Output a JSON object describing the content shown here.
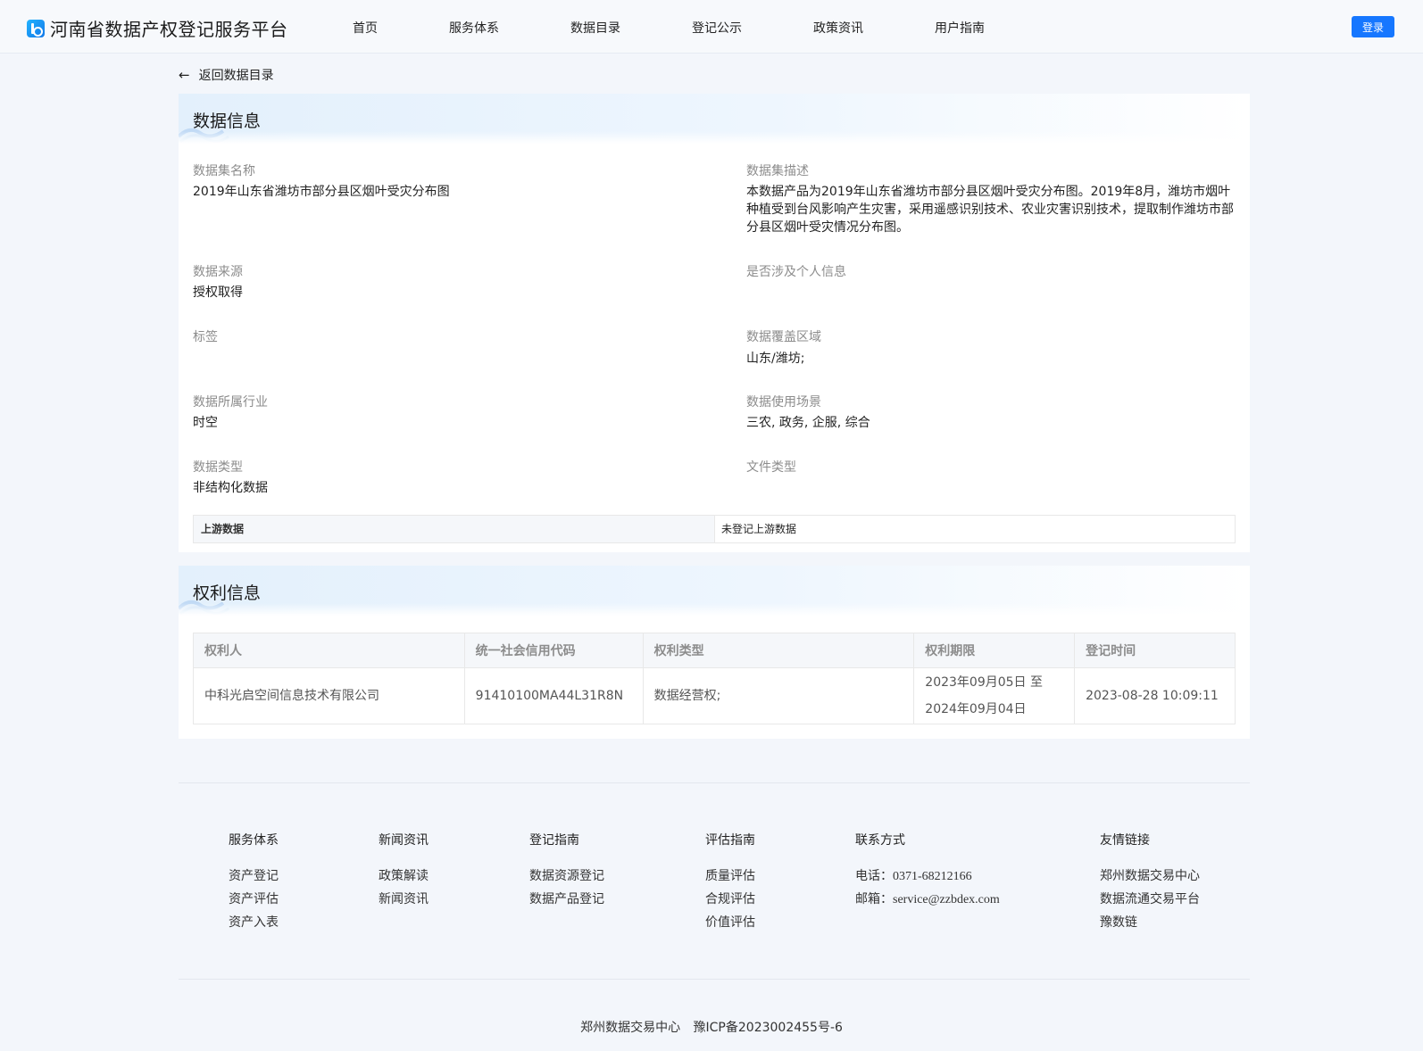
{
  "header": {
    "title": "河南省数据产权登记服务平台",
    "nav": [
      "首页",
      "服务体系",
      "数据目录",
      "登记公示",
      "政策资讯",
      "用户指南"
    ],
    "login": "登录"
  },
  "back_link": "返回数据目录",
  "data_info": {
    "title": "数据信息",
    "fields": {
      "name": {
        "label": "数据集名称",
        "value": "2019年山东省潍坊市部分县区烟叶受灾分布图"
      },
      "description": {
        "label": "数据集描述",
        "value": "本数据产品为2019年山东省潍坊市部分县区烟叶受灾分布图。2019年8月，潍坊市烟叶种植受到台风影响产生灾害，采用遥感识别技术、农业灾害识别技术，提取制作潍坊市部分县区烟叶受灾情况分布图。"
      },
      "source": {
        "label": "数据来源",
        "value": "授权取得"
      },
      "personal_info": {
        "label": "是否涉及个人信息",
        "value": ""
      },
      "tags": {
        "label": "标签",
        "value": ""
      },
      "coverage": {
        "label": "数据覆盖区域",
        "value": "山东/潍坊;"
      },
      "industry": {
        "label": "数据所属行业",
        "value": "时空"
      },
      "scenario": {
        "label": "数据使用场景",
        "value": "三农, 政务, 企服, 综合"
      },
      "data_type": {
        "label": "数据类型",
        "value": "非结构化数据"
      },
      "file_type": {
        "label": "文件类型",
        "value": ""
      }
    },
    "upstream": {
      "label": "上游数据",
      "value": "未登记上游数据"
    }
  },
  "rights_info": {
    "title": "权利信息",
    "columns": [
      "权利人",
      "统一社会信用代码",
      "权利类型",
      "权利期限",
      "登记时间"
    ],
    "rows": [
      {
        "holder": "中科光启空间信息技术有限公司",
        "credit_code": "91410100MA44L31R8N",
        "right_type": "数据经营权;",
        "period_start": "2023年09月05日 至",
        "period_end": "2024年09月04日",
        "registered": "2023-08-28 10:09:11"
      }
    ]
  },
  "footer": {
    "columns": [
      {
        "title": "服务体系",
        "links": [
          "资产登记",
          "资产评估",
          "资产入表"
        ]
      },
      {
        "title": "新闻资讯",
        "links": [
          "政策解读",
          "新闻资讯"
        ]
      },
      {
        "title": "登记指南",
        "links": [
          "数据资源登记",
          "数据产品登记"
        ]
      },
      {
        "title": "评估指南",
        "links": [
          "质量评估",
          "合规评估",
          "价值评估"
        ]
      },
      {
        "title": "联系方式",
        "links": [
          "电话：0371-68212166",
          "邮箱：service@zzbdex.com"
        ]
      },
      {
        "title": "友情链接",
        "links": [
          "郑州数据交易中心",
          "数据流通交易平台",
          "豫数链"
        ]
      }
    ],
    "copyright_org": "郑州数据交易中心",
    "icp": "豫ICP备2023002455号-6"
  }
}
